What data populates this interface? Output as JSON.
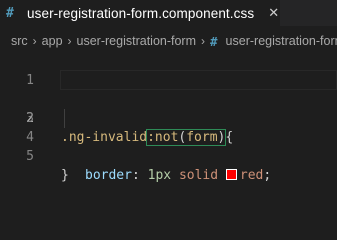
{
  "tab": {
    "icon": "#",
    "label": "user-registration-form.component.css",
    "close": "✕"
  },
  "breadcrumb": {
    "items": [
      "src",
      "app",
      "user-registration-form",
      "user-registration-form.component.css"
    ],
    "file_icon": "#",
    "separator": "›"
  },
  "editor": {
    "line_numbers": [
      "1",
      "2",
      "3",
      "4",
      "5"
    ],
    "line3": {
      "selector": ".ng-invalid",
      "pseudo": ":not",
      "open": "(",
      "arg": "form",
      "close": ")",
      "brace": "{"
    },
    "line4": {
      "property": "border",
      "colon": ":",
      "number": "1px",
      "style": "solid",
      "color_value": "red",
      "semicolon": ";"
    },
    "line5": {
      "brace": "}"
    },
    "swatch_color": "#ff0000"
  }
}
